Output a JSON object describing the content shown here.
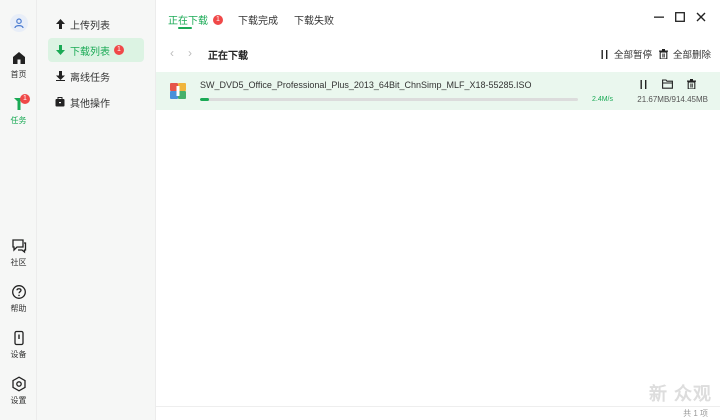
{
  "rail": {
    "items": [
      {
        "label": "首页"
      },
      {
        "label": "任务",
        "badge": "1"
      },
      {
        "label": "社区"
      },
      {
        "label": "帮助"
      },
      {
        "label": "设备"
      },
      {
        "label": "设置"
      }
    ]
  },
  "sidebar": {
    "items": [
      {
        "label": "上传列表"
      },
      {
        "label": "下载列表",
        "badge": "1"
      },
      {
        "label": "离线任务"
      },
      {
        "label": "其他操作"
      }
    ]
  },
  "tabs": [
    {
      "label": "正在下载",
      "badge": "1"
    },
    {
      "label": "下载完成"
    },
    {
      "label": "下载失败"
    }
  ],
  "toolbar": {
    "title": "正在下载",
    "pause_all": "全部暂停",
    "delete_all": "全部删除"
  },
  "download": {
    "filename": "SW_DVD5_Office_Professional_Plus_2013_64Bit_ChnSimp_MLF_X18-55285.ISO",
    "speed": "2.4M/s",
    "size": "21.67MB/914.45MB",
    "progress_percent": 2.4
  },
  "footer": {
    "count": "共 1 项"
  },
  "watermark": "新 众观",
  "colors": {
    "accent": "#1aaa55",
    "badge": "#f04848",
    "row_bg": "#eaf7ee"
  }
}
